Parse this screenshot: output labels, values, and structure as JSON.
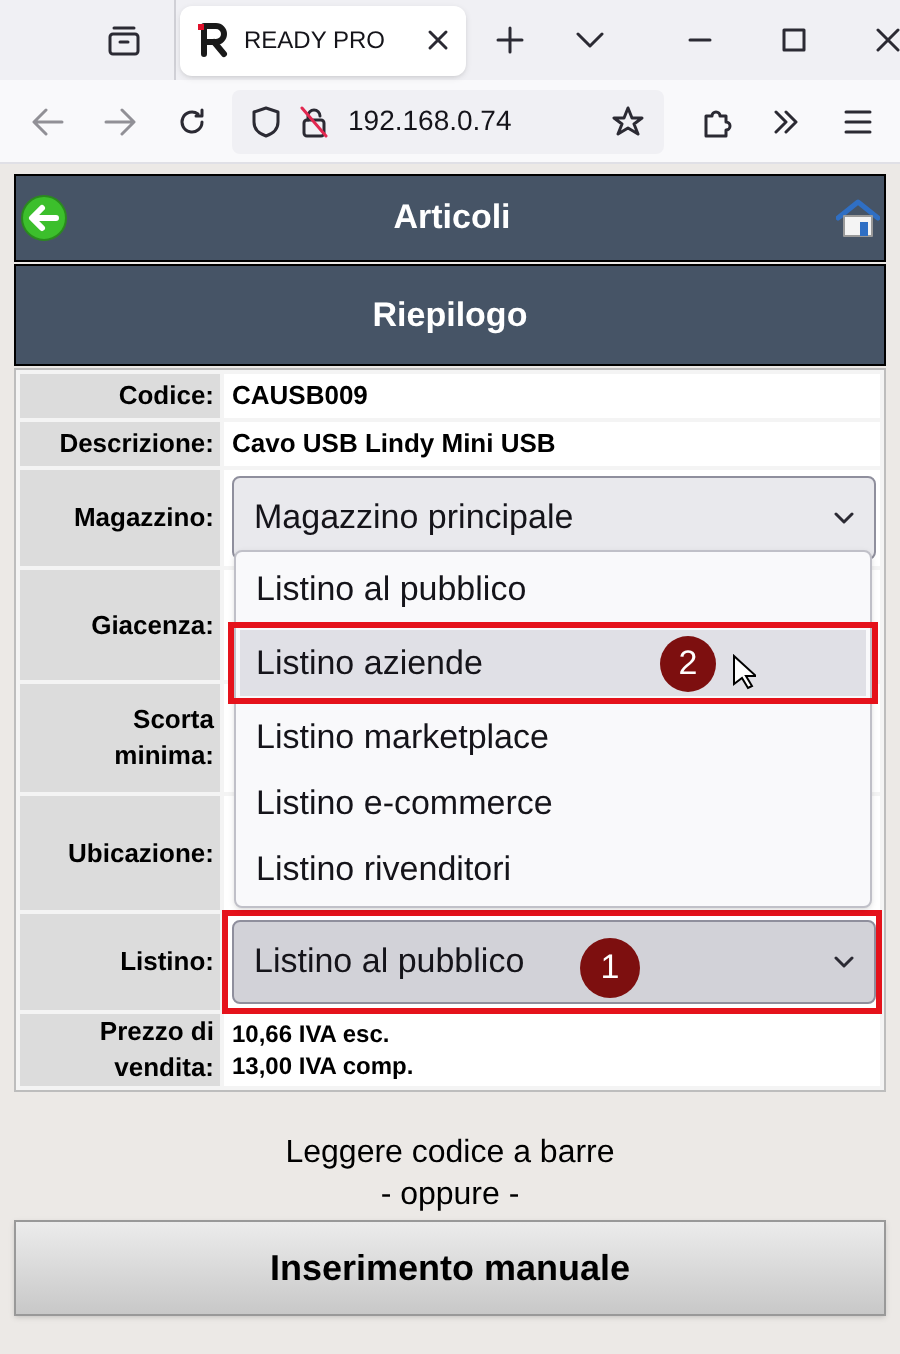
{
  "browser": {
    "tab_title": "READY PRO",
    "url": "192.168.0.74"
  },
  "header": {
    "title": "Articoli"
  },
  "section": {
    "title": "Riepilogo"
  },
  "fields": [
    {
      "label": "Codice:",
      "kind": "text",
      "value": "CAUSB009"
    },
    {
      "label": "Descrizione:",
      "kind": "text",
      "value": "Cavo USB Lindy Mini USB"
    },
    {
      "label": "Magazzino:",
      "kind": "select",
      "value": "Magazzino principale",
      "expanded": false
    },
    {
      "label": "Giacenza:",
      "kind": "covered"
    },
    {
      "label": "Scorta minima:",
      "kind": "covered"
    },
    {
      "label": "Ubicazione:",
      "kind": "covered"
    },
    {
      "label": "Listino:",
      "kind": "select",
      "value": "Listino al pubblico",
      "expanded": true,
      "callout": "1",
      "options": [
        {
          "label": "Listino al pubblico",
          "highlighted": false
        },
        {
          "label": "Listino aziende",
          "highlighted": true,
          "callout": "2"
        },
        {
          "label": "Listino marketplace",
          "highlighted": false
        },
        {
          "label": "Listino e-commerce",
          "highlighted": false
        },
        {
          "label": "Listino rivenditori",
          "highlighted": false
        }
      ]
    },
    {
      "label": "Prezzo di vendita:",
      "kind": "lines",
      "lines": [
        "10,66 IVA esc.",
        "13,00 IVA comp."
      ]
    }
  ],
  "scan_prompt": {
    "line1": "Leggere codice a barre",
    "line2": "- oppure -"
  },
  "manual_button": "Inserimento manuale"
}
